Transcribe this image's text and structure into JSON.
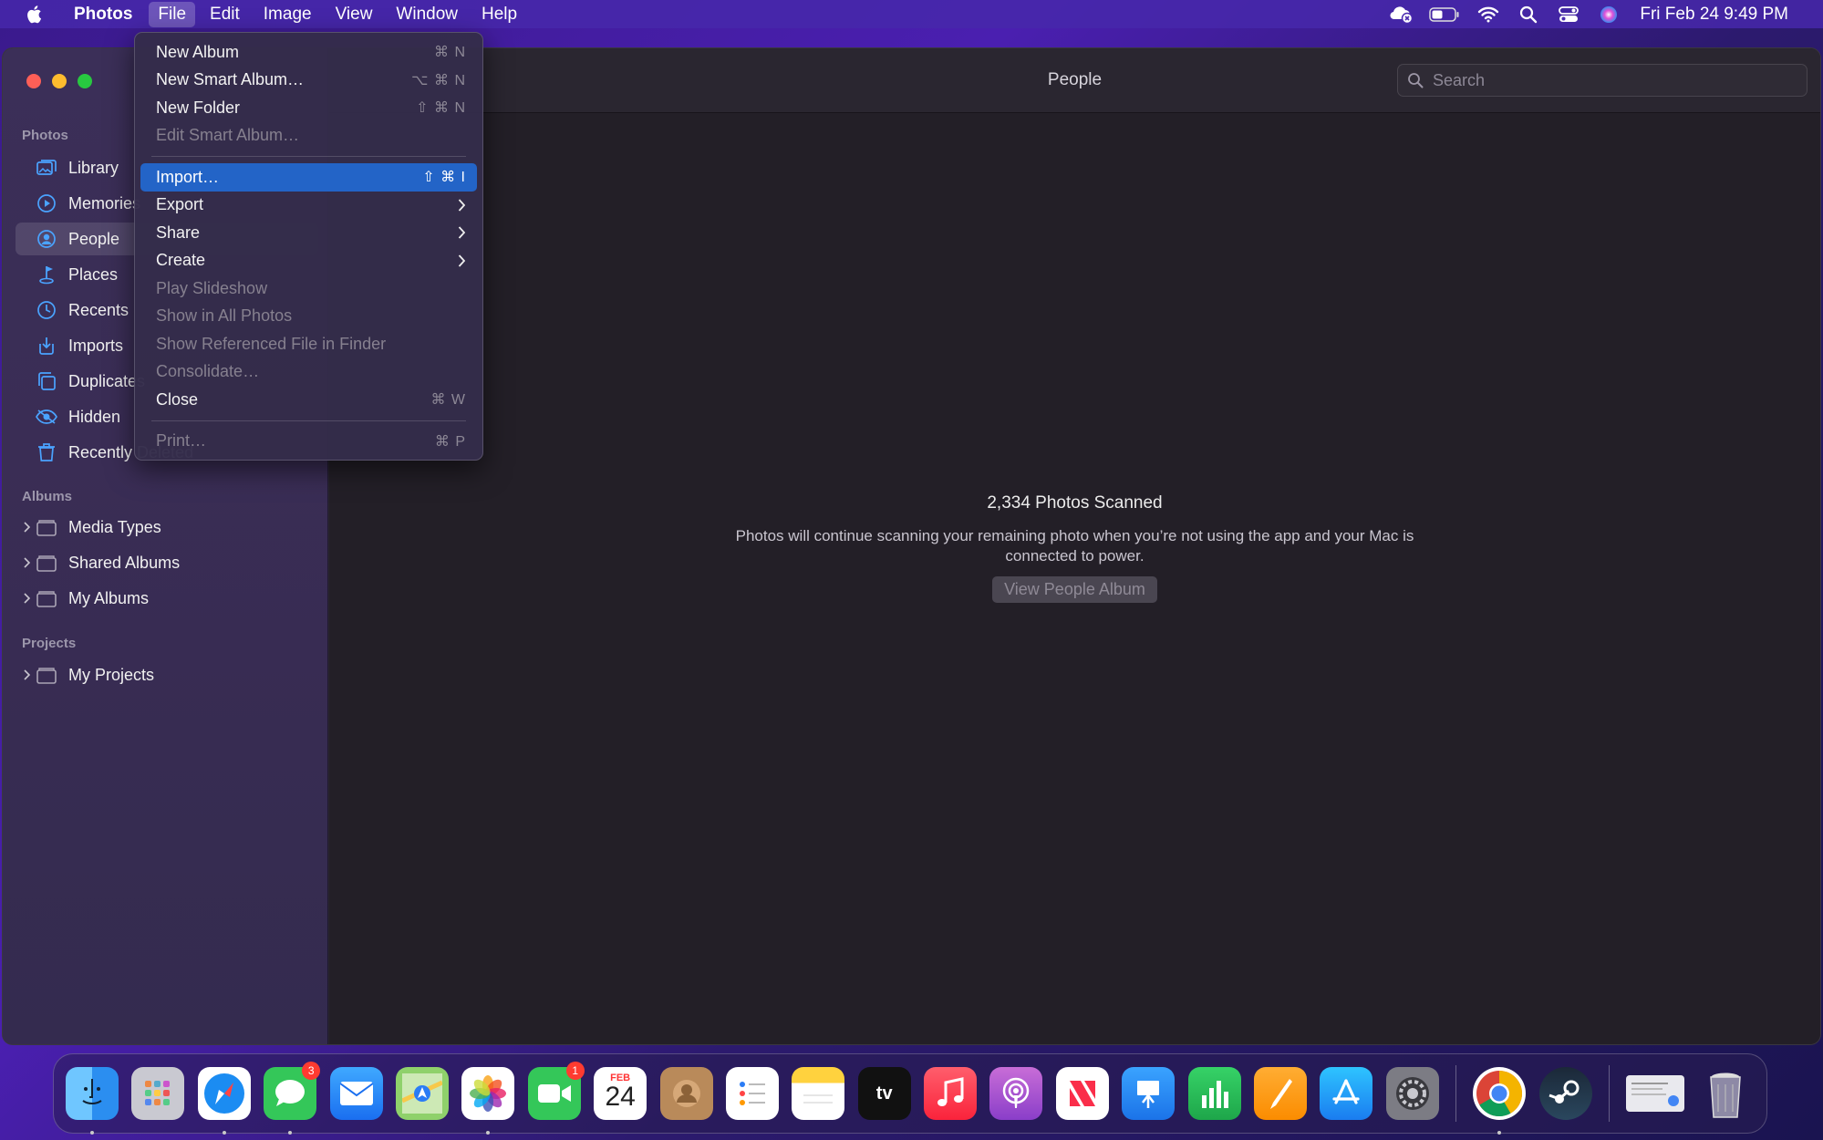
{
  "menubar": {
    "app_name": "Photos",
    "items": [
      "File",
      "Edit",
      "Image",
      "View",
      "Window",
      "Help"
    ],
    "active_item": "File",
    "clock": "Fri Feb 24  9:49 PM",
    "status_icons": [
      "cloud-error-icon",
      "battery-icon",
      "wifi-icon",
      "spotlight-icon",
      "control-center-icon",
      "siri-icon"
    ]
  },
  "window": {
    "title": "People",
    "search": {
      "placeholder": "Search",
      "value": ""
    }
  },
  "sidebar": {
    "photos_header": "Photos",
    "photos_items": [
      {
        "label": "Library",
        "icon": "library-icon"
      },
      {
        "label": "Memories",
        "icon": "memories-icon"
      },
      {
        "label": "People",
        "icon": "people-icon",
        "selected": true
      },
      {
        "label": "Places",
        "icon": "places-icon"
      },
      {
        "label": "Recents",
        "icon": "recents-icon"
      },
      {
        "label": "Imports",
        "icon": "imports-icon"
      },
      {
        "label": "Duplicates",
        "icon": "duplicates-icon"
      },
      {
        "label": "Hidden",
        "icon": "hidden-icon"
      },
      {
        "label": "Recently Deleted",
        "icon": "trash-icon"
      }
    ],
    "albums_header": "Albums",
    "album_items": [
      {
        "label": "Media Types"
      },
      {
        "label": "Shared Albums"
      },
      {
        "label": "My Albums"
      }
    ],
    "projects_header": "Projects",
    "project_items": [
      {
        "label": "My Projects"
      }
    ]
  },
  "content": {
    "heading": "2,334 Photos Scanned",
    "description_line1": "Photos will continue scanning your remaining photo when you’re not using the app and your Mac is",
    "description_line2": "connected to power.",
    "button_label": "View People Album"
  },
  "file_menu": {
    "items": [
      {
        "label": "New Album",
        "shortcut": "⌘ N"
      },
      {
        "label": "New Smart Album…",
        "shortcut": "⌥ ⌘ N"
      },
      {
        "label": "New Folder",
        "shortcut": "⇧ ⌘ N"
      },
      {
        "label": "Edit Smart Album…",
        "shortcut": "",
        "disabled": true
      },
      {
        "label": "Import…",
        "shortcut": "⇧ ⌘  I",
        "highlight": true
      },
      {
        "label": "Export",
        "submenu": true
      },
      {
        "label": "Share",
        "submenu": true
      },
      {
        "label": "Create",
        "submenu": true
      },
      {
        "label": "Play Slideshow",
        "disabled": true
      },
      {
        "label": "Show in All Photos",
        "disabled": true
      },
      {
        "label": "Show Referenced File in Finder",
        "disabled": true
      },
      {
        "label": "Consolidate…",
        "disabled": true
      },
      {
        "label": "Close",
        "shortcut": "⌘ W"
      },
      {
        "label": "Print…",
        "shortcut": "⌘ P",
        "disabled": true
      }
    ]
  },
  "dock": {
    "apps": [
      {
        "name": "finder-icon",
        "running": true
      },
      {
        "name": "launchpad-icon"
      },
      {
        "name": "safari-icon",
        "running": true
      },
      {
        "name": "messages-icon",
        "badge": "3",
        "running": true
      },
      {
        "name": "mail-icon"
      },
      {
        "name": "maps-icon"
      },
      {
        "name": "photos-icon",
        "running": true
      },
      {
        "name": "facetime-icon",
        "badge": "1"
      },
      {
        "name": "calendar-icon",
        "month": "FEB",
        "day": "24"
      },
      {
        "name": "contacts-icon"
      },
      {
        "name": "reminders-icon"
      },
      {
        "name": "notes-icon"
      },
      {
        "name": "appletv-icon",
        "label": "tv"
      },
      {
        "name": "music-icon"
      },
      {
        "name": "podcasts-icon"
      },
      {
        "name": "news-icon"
      },
      {
        "name": "keynote-icon"
      },
      {
        "name": "numbers-icon"
      },
      {
        "name": "pages-icon"
      },
      {
        "name": "appstore-icon"
      },
      {
        "name": "system-preferences-icon"
      },
      {
        "name": "chrome-icon",
        "running": true
      },
      {
        "name": "steam-icon"
      },
      {
        "name": "downloads-stack-icon"
      },
      {
        "name": "trash-icon"
      }
    ]
  },
  "colors": {
    "accent": "#2364c7",
    "badge": "#ff3b30",
    "traffic_close": "#fe5f57",
    "traffic_min": "#febc2e",
    "traffic_max": "#28c840"
  }
}
